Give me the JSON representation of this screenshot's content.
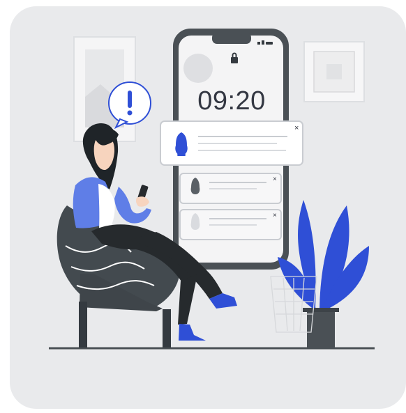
{
  "phone": {
    "lock_time": "09:20"
  },
  "notifications": [
    {
      "icon": "bell-icon",
      "state": "active"
    },
    {
      "icon": "bell-icon",
      "state": "muted"
    },
    {
      "icon": "bell-icon",
      "state": "muted"
    }
  ],
  "colors": {
    "background": "#e9eaec",
    "accent_blue": "#2f4fd6",
    "dark_gray": "#333742",
    "chair": "#434a4f",
    "alert_blue": "#2f4fd6"
  }
}
